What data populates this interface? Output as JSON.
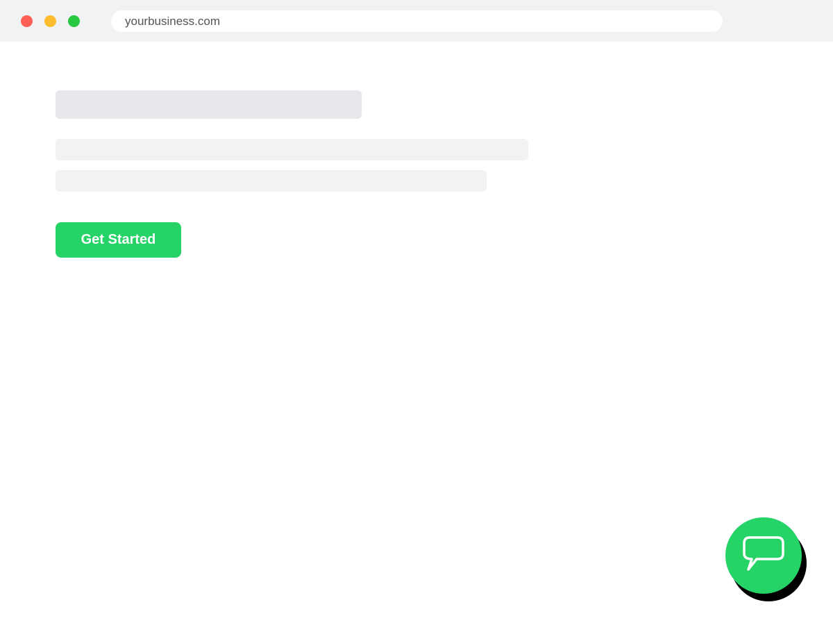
{
  "browser": {
    "url": "yourbusiness.com",
    "traffic_lights": {
      "close_color": "#ff5f57",
      "minimize_color": "#febc2e",
      "maximize_color": "#28c840"
    }
  },
  "hero": {
    "cta_label": "Get Started"
  },
  "chat_widget": {
    "icon": "chat-bubble-icon"
  },
  "colors": {
    "accent": "#25d366",
    "chrome_bg": "#f1f2f4",
    "placeholder_dark": "#e7e8eb",
    "placeholder_light": "#f1f2f4"
  }
}
